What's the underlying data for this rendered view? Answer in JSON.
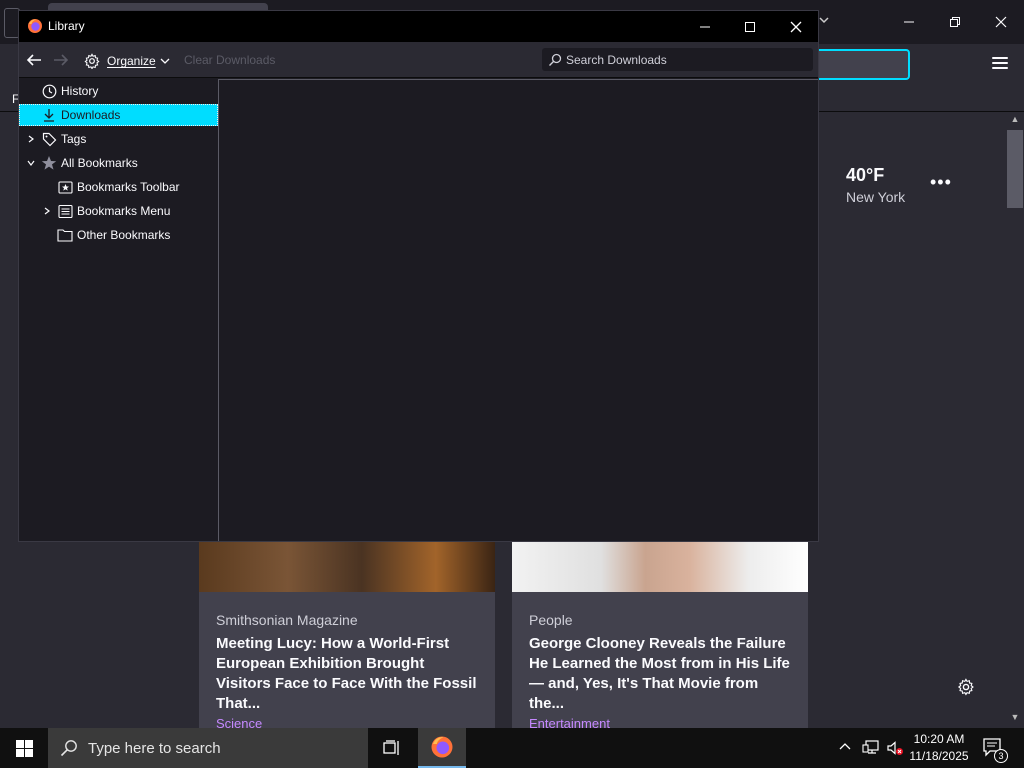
{
  "library": {
    "title": "Library",
    "organize_label": "Organize",
    "clear_downloads_label": "Clear Downloads",
    "search_placeholder": "Search Downloads",
    "tree": [
      {
        "label": "History"
      },
      {
        "label": "Downloads",
        "selected": true
      },
      {
        "label": "Tags"
      },
      {
        "label": "All Bookmarks"
      },
      {
        "label": "Bookmarks Toolbar"
      },
      {
        "label": "Bookmarks Menu"
      },
      {
        "label": "Other Bookmarks"
      }
    ]
  },
  "browser": {
    "bookmarks_bar_letter": "F",
    "weather": {
      "temp": "40°F",
      "city": "New York"
    },
    "cards": [
      {
        "source": "Smithsonian Magazine",
        "title": "Meeting Lucy: How a World-First European Exhibition Brought Visitors Face to Face With the Fossil That...",
        "tag": "Science"
      },
      {
        "source": "People",
        "title": "George Clooney Reveals the Failure He Learned the Most from in His Life — and, Yes, It's That Movie from the...",
        "tag": "Entertainment"
      }
    ]
  },
  "taskbar": {
    "search_placeholder": "Type here to search",
    "time": "10:20 AM",
    "date": "11/18/2025",
    "notification_count": "3"
  },
  "colors": {
    "accent": "#00ddff",
    "tag_purple": "#c689ff",
    "taskbar_highlight": "#76b9ed"
  }
}
